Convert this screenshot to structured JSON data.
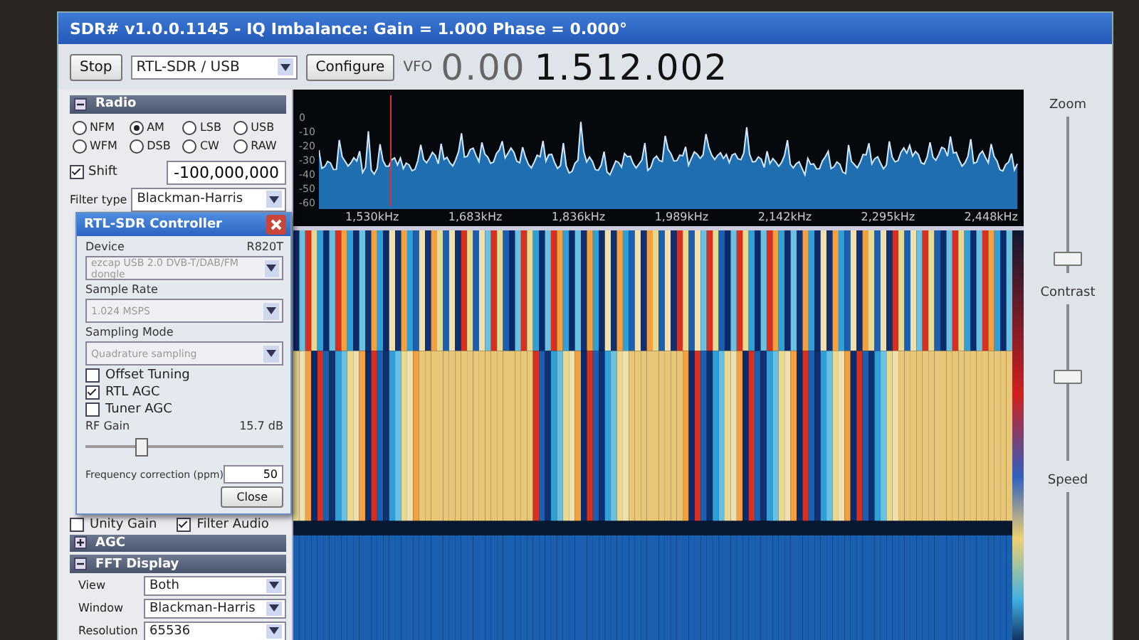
{
  "window": {
    "title": "SDR# v1.0.0.1145 - IQ Imbalance: Gain = 1.000 Phase = 0.000°"
  },
  "toolbar": {
    "stop_button": "Stop",
    "source": "RTL-SDR / USB",
    "configure_button": "Configure",
    "vfo_label": "VFO",
    "vfo_dim": "0.00",
    "vfo_bright": "1.512.002"
  },
  "radio": {
    "title": "Radio",
    "expanded": true,
    "modes": [
      {
        "label": "NFM",
        "selected": false
      },
      {
        "label": "AM",
        "selected": true
      },
      {
        "label": "LSB",
        "selected": false
      },
      {
        "label": "USB",
        "selected": false
      },
      {
        "label": "WFM",
        "selected": false
      },
      {
        "label": "DSB",
        "selected": false
      },
      {
        "label": "CW",
        "selected": false
      },
      {
        "label": "RAW",
        "selected": false
      }
    ],
    "shift": {
      "label": "Shift",
      "checked": true,
      "value": "-100,000,000"
    },
    "filter_label": "Filter type",
    "filter_value": "Blackman-Harris",
    "options": [
      {
        "label": "Unity Gain",
        "checked": false
      },
      {
        "label": "Filter Audio",
        "checked": true
      }
    ]
  },
  "sections": [
    {
      "title": "AGC",
      "expanded": false
    },
    {
      "title": "FFT Display",
      "expanded": true,
      "fields": [
        {
          "label": "View",
          "value": "Both"
        },
        {
          "label": "Window",
          "value": "Blackman-Harris"
        },
        {
          "label": "Resolution",
          "value": "65536"
        }
      ]
    }
  ],
  "spectrum": {
    "y_labels": [
      "0",
      "-10",
      "-20",
      "-30",
      "-40",
      "-50",
      "-60"
    ],
    "x_labels": [
      "1,530kHz",
      "1,683kHz",
      "1,836kHz",
      "1,989kHz",
      "2,142kHz",
      "2,295kHz",
      "2,448kHz"
    ]
  },
  "sliders": [
    {
      "label": "Zoom",
      "level": 0.1
    },
    {
      "label": "Contrast",
      "level": 0.55
    },
    {
      "label": "Speed"
    }
  ],
  "dialog": {
    "title": "RTL-SDR Controller",
    "device_label": "Device",
    "tuner": "R820T",
    "device": "ezcap USB 2.0 DVB-T/DAB/FM dongle",
    "rate_label": "Sample Rate",
    "rate": "1.024 MSPS",
    "mode_label": "Sampling Mode",
    "mode": "Quadrature sampling",
    "checks": [
      {
        "label": "Offset Tuning",
        "checked": false
      },
      {
        "label": "RTL AGC",
        "checked": true
      },
      {
        "label": "Tuner AGC",
        "checked": false
      }
    ],
    "gain_label": "RF Gain",
    "gain_value": "15.7 dB",
    "gain": {
      "level": 0.28
    },
    "ppm_label": "Frequency correction (ppm)",
    "ppm": "50",
    "close_button": "Close"
  }
}
